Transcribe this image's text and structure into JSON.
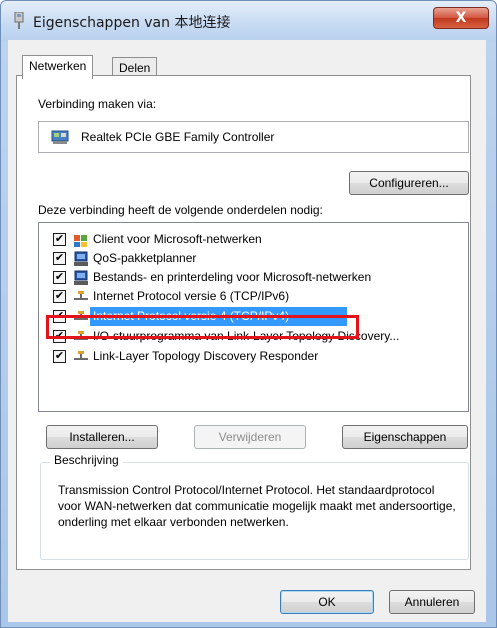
{
  "window": {
    "title": "Eigenschappen van 本地连接",
    "close_glyph": "X"
  },
  "tabs": [
    {
      "label": "Netwerken",
      "active": true
    },
    {
      "label": "Delen",
      "active": false
    }
  ],
  "connect_via": {
    "label": "Verbinding maken via:",
    "adapter": "Realtek PCIe GBE Family Controller",
    "configure_button": "Configureren..."
  },
  "components": {
    "label": "Deze verbinding heeft de volgende onderdelen nodig:",
    "items": [
      {
        "label": "Client voor Microsoft-netwerken",
        "checked": true,
        "icon": "network-client-icon"
      },
      {
        "label": "QoS-pakketplanner",
        "checked": true,
        "icon": "qos-scheduler-icon"
      },
      {
        "label": "Bestands- en printerdeling voor Microsoft-netwerken",
        "checked": true,
        "icon": "file-printer-sharing-icon"
      },
      {
        "label": "Internet Protocol versie 6 (TCP/IPv6)",
        "checked": true,
        "icon": "protocol-icon"
      },
      {
        "label": "Internet Protocol versie 4 (TCP/IPv4)",
        "checked": true,
        "icon": "protocol-icon",
        "selected": true,
        "highlighted": true
      },
      {
        "label": "I/O-stuurprogramma van Link-Layer Topology Discovery...",
        "checked": true,
        "icon": "protocol-icon"
      },
      {
        "label": "Link-Layer Topology Discovery Responder",
        "checked": true,
        "icon": "protocol-icon"
      }
    ],
    "check_glyph": "✔"
  },
  "actions": {
    "install": "Installeren...",
    "uninstall": "Verwijderen",
    "properties": "Eigenschappen"
  },
  "description": {
    "title": "Beschrijving",
    "text": "Transmission Control Protocol/Internet Protocol. Het standaardprotocol voor WAN-netwerken dat communicatie mogelijk maakt met andersoortige, onderling met elkaar verbonden netwerken."
  },
  "footer": {
    "ok": "OK",
    "cancel": "Annuleren"
  },
  "colors": {
    "selection": "#3399ff",
    "highlight_box": "#e3131b",
    "close_button": "#c0391f"
  }
}
